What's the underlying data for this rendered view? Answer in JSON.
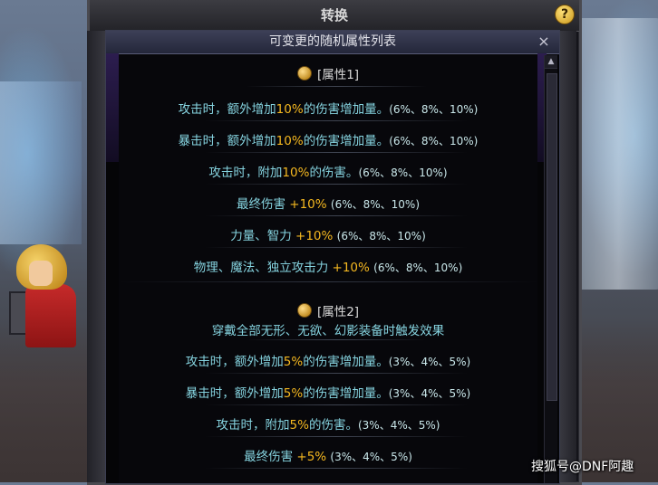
{
  "back_window": {
    "title": "转换",
    "help_label": "?"
  },
  "popup": {
    "title": "可变更的随机属性列表",
    "close_label": "×",
    "section1": {
      "heading": "[属性1]",
      "rows": [
        {
          "pre": "攻击时，额外增加",
          "hl": "10%",
          "post": "的伤害增加量。",
          "range": "(6%、8%、10%)"
        },
        {
          "pre": "暴击时，额外增加",
          "hl": "10%",
          "post": "的伤害增加量。",
          "range": "(6%、8%、10%)"
        },
        {
          "pre": "攻击时，附加",
          "hl": "10%",
          "post": "的伤害。",
          "range": "(6%、8%、10%)"
        },
        {
          "pre": "最终伤害 ",
          "hl": "+10%",
          "post": "",
          "range": "(6%、8%、10%)"
        },
        {
          "pre": "力量、智力 ",
          "hl": "+10%",
          "post": "",
          "range": "(6%、8%、10%)"
        },
        {
          "pre": "物理、魔法、独立攻击力 ",
          "hl": "+10%",
          "post": "",
          "range": "(6%、8%、10%)"
        }
      ]
    },
    "section2": {
      "heading": "[属性2]",
      "condition": "穿戴全部无形、无欲、幻影装备时触发效果",
      "rows": [
        {
          "pre": "攻击时，额外增加",
          "hl": "5%",
          "post": "的伤害增加量。",
          "range": "(3%、4%、5%)"
        },
        {
          "pre": "暴击时，额外增加",
          "hl": "5%",
          "post": "的伤害增加量。",
          "range": "(3%、4%、5%)"
        },
        {
          "pre": "攻击时，附加",
          "hl": "5%",
          "post": "的伤害。",
          "range": "(3%、4%、5%)"
        },
        {
          "pre": "最终伤害 ",
          "hl": "+5%",
          "post": "",
          "range": "(3%、4%、5%)"
        }
      ]
    }
  },
  "watermark": "搜狐号@DNF阿趣",
  "colors": {
    "value_highlight": "#f5b820",
    "effect_text": "#86d4e0",
    "popup_bg": "#050507"
  }
}
